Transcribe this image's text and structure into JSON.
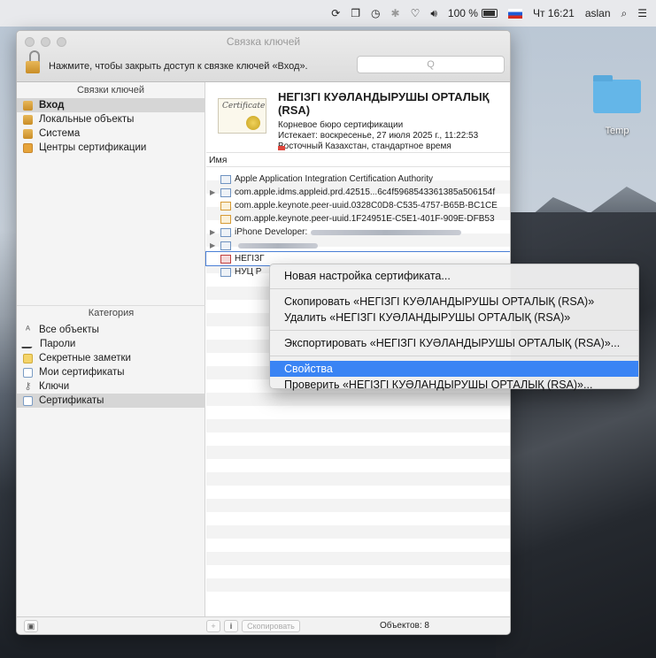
{
  "menubar": {
    "battery": "100 %",
    "clock": "Чт 16:21",
    "user": "aslan"
  },
  "desktop": {
    "folder_label": "Temp"
  },
  "window": {
    "title": "Связка ключей",
    "lock_text": "Нажмите, чтобы закрыть доступ к связке ключей «Вход».",
    "search_placeholder": "Q"
  },
  "sidebar": {
    "keychains_header": "Связки ключей",
    "keychains": [
      {
        "label": "Вход",
        "icon": "lock-icon",
        "selected": true
      },
      {
        "label": "Локальные объекты",
        "icon": "lock-icon"
      },
      {
        "label": "Система",
        "icon": "lock-icon"
      },
      {
        "label": "Центры сертификации",
        "icon": "cert-folder-icon"
      }
    ],
    "category_header": "Категория",
    "categories": [
      {
        "label": "Все объекты",
        "icon": "all-items-icon"
      },
      {
        "label": "Пароли",
        "icon": "passwords-icon"
      },
      {
        "label": "Секретные заметки",
        "icon": "notes-icon"
      },
      {
        "label": "Мои сертификаты",
        "icon": "my-certs-icon"
      },
      {
        "label": "Ключи",
        "icon": "key-icon"
      },
      {
        "label": "Сертификаты",
        "icon": "certificate-icon",
        "selected": true
      }
    ]
  },
  "cert": {
    "image_text": "Certificate",
    "name_line1": "НЕГІЗГІ КУӘЛАНДЫРУШЫ ОРТАЛЫҚ",
    "name_line2": "(RSA)",
    "type": "Корневое бюро сертификации",
    "expires": "Истекает: воскресенье, 27 июля 2025 г., 11:22:53",
    "tz": "Восточный Казахстан, стандартное время"
  },
  "list": {
    "column": "Имя",
    "rows": [
      {
        "label": "Apple Application Integration Certification Authority"
      },
      {
        "label": "com.apple.idms.appleid.prd.42515...6c4f5968543361385a506154f"
      },
      {
        "label": "com.apple.keynote.peer-uuid.0328C0D8-C535-4757-B65B-BC1CE"
      },
      {
        "label": "com.apple.keynote.peer-uuid.1F24951E-C5E1-401F-909E-DFB53"
      },
      {
        "label": "iPhone Developer:"
      },
      {
        "label": ""
      },
      {
        "label": "НЕГІЗГ"
      },
      {
        "label": "НУЦ Р"
      }
    ]
  },
  "bottom": {
    "add": "+",
    "info": "i",
    "copy": "Скопировать",
    "count": "Объектов: 8"
  },
  "context_menu": {
    "new_pref": "Новая настройка сертификата...",
    "copy": "Скопировать «НЕГІЗГІ КУӘЛАНДЫРУШЫ ОРТАЛЫҚ (RSA)»",
    "delete": "Удалить «НЕГІЗГІ КУӘЛАНДЫРУШЫ ОРТАЛЫҚ (RSA)»",
    "export": "Экспортировать «НЕГІЗГІ КУӘЛАНДЫРУШЫ ОРТАЛЫҚ (RSA)»...",
    "properties": "Свойства",
    "verify": "Проверить «НЕГІЗГІ КУӘЛАНДЫРУШЫ ОРТАЛЫҚ (RSA)»..."
  }
}
